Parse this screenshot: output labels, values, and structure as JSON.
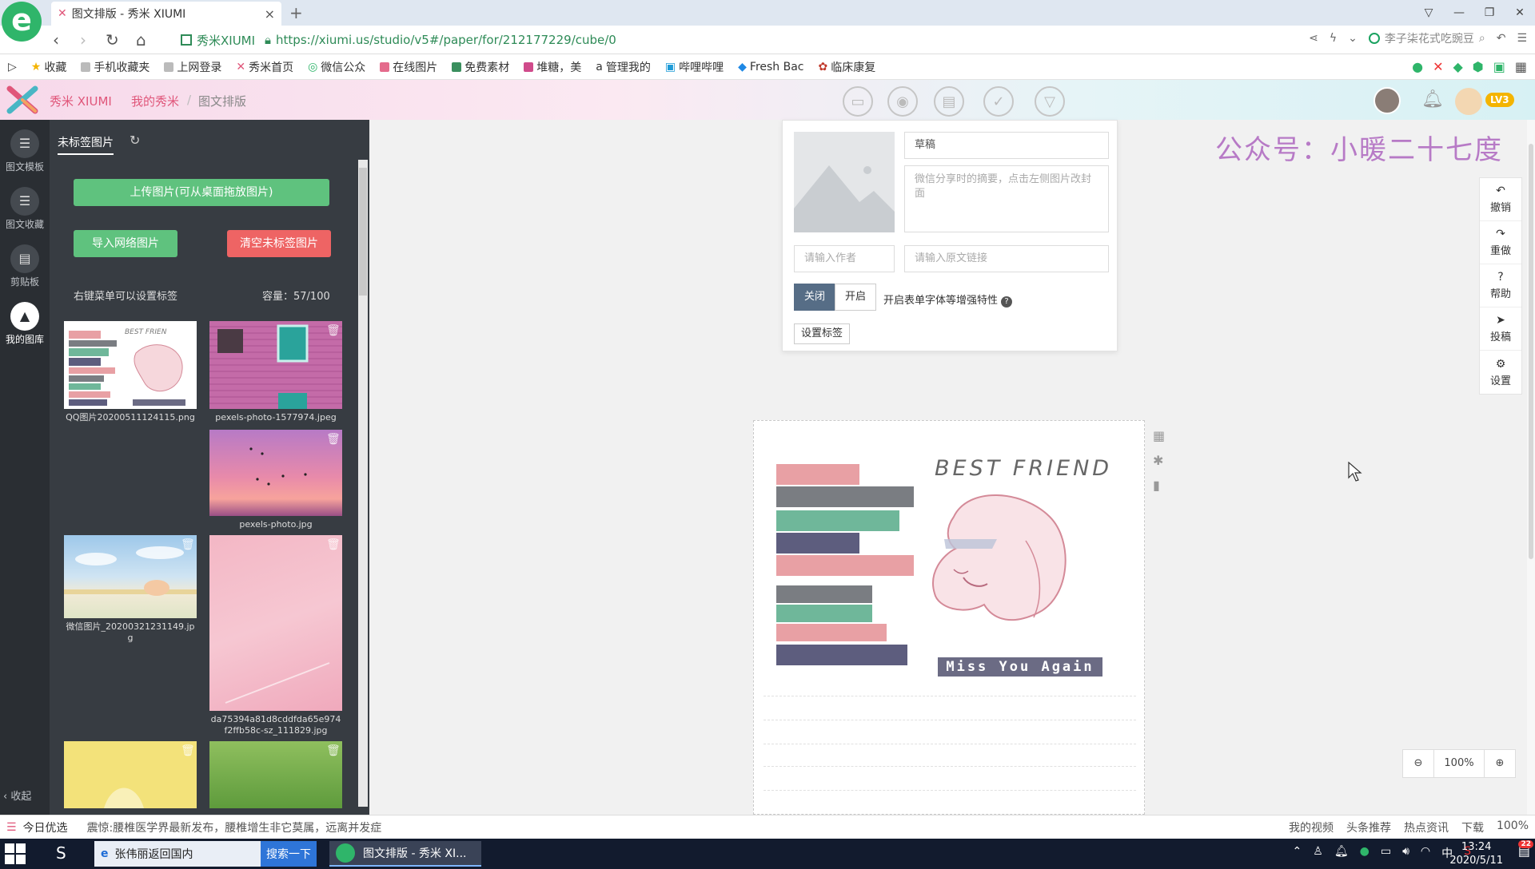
{
  "browser": {
    "tab_title": "图文排版 - 秀米 XIUMI",
    "site_name": "秀米XIUMI",
    "url": "https://xiumi.us/studio/v5#/paper/for/212177229/cube/0",
    "search_placeholder": "李子柒花式吃豌豆",
    "bookmarks": [
      "收藏",
      "手机收藏夹",
      "上网登录",
      "秀米首页",
      "微信公众",
      "在线图片",
      "免费素材",
      "堆糖，美",
      "管理我的",
      "哔哩哔哩",
      "Fresh Bac",
      "临床康复"
    ]
  },
  "app": {
    "brand": "秀米 XIUMI",
    "breadcrumb": [
      "我的秀米",
      "图文排版"
    ],
    "level_badge": "LV3"
  },
  "rail": {
    "items": [
      "图文模板",
      "图文收藏",
      "剪贴板",
      "我的图库"
    ],
    "collapse": "收起"
  },
  "library": {
    "tab": "未标签图片",
    "upload_label": "上传图片(可从桌面拖放图片)",
    "import_label": "导入网络图片",
    "clear_label": "清空未标签图片",
    "hint": "右键菜单可以设置标签",
    "capacity": "容量：57/100",
    "images": [
      {
        "name": "QQ图片20200511124115.png"
      },
      {
        "name": "pexels-photo-1577974.jpeg"
      },
      {
        "name": "pexels-photo.jpg"
      },
      {
        "name": "微信图片_20200321231149.jpg"
      },
      {
        "name": "da75394a81d8cddfda65e974f2ffb58c-sz_111829.jpg"
      },
      {
        "name": ""
      },
      {
        "name": ""
      }
    ]
  },
  "meta": {
    "title_value": "草稿",
    "summary_placeholder": "微信分享时的摘要，点击左侧图片改封面",
    "author_placeholder": "请输入作者",
    "link_placeholder": "请输入原文链接",
    "toggle_off": "关闭",
    "toggle_on": "开启",
    "toggle_label": "开启表单字体等增强特性",
    "tag_button": "设置标签"
  },
  "watermark": "公众号：小暖二十七度",
  "article": {
    "title": "BEST FRIEND",
    "banner": "Miss You Again"
  },
  "right_tools": [
    "撤销",
    "重做",
    "帮助",
    "投稿",
    "设置"
  ],
  "zoom": "100%",
  "statusbar": {
    "left": "今日优选",
    "news": "震惊:腰椎医学界最新发布，腰椎增生非它莫属，远离并发症",
    "right": [
      "我的视频",
      "头条推荐",
      "热点资讯",
      "下载",
      "100%"
    ]
  },
  "taskbar": {
    "search_text": "张伟丽返回国内",
    "search_button": "搜索一下",
    "app_title": "图文排版 - 秀米 XI...",
    "time": "13:24",
    "date": "2020/5/11",
    "input_method": "中",
    "notify_count": "22"
  },
  "colors": {
    "accent_pink": "#e0567a",
    "green_button": "#5fc27e",
    "red_button": "#ee6464",
    "sidebar_dark": "#2a2e33",
    "panel_dark": "#373c42",
    "watermark": "#b77ac6",
    "toggle_active": "#566d86"
  }
}
